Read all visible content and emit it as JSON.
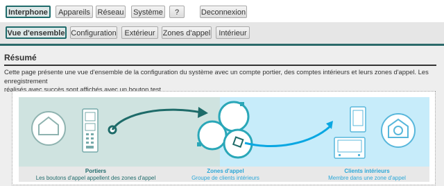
{
  "top_nav": {
    "items": [
      {
        "label": "Interphone",
        "active": true
      },
      {
        "label": "Appareils",
        "active": false
      },
      {
        "label": "Réseau",
        "active": false
      },
      {
        "label": "Système",
        "active": false
      },
      {
        "label": "?",
        "active": false
      }
    ],
    "logout_label": "Deconnexion"
  },
  "sub_nav": {
    "items": [
      {
        "label": "Vue d'ensemble",
        "active": true
      },
      {
        "label": "Configuration",
        "active": false
      },
      {
        "label": "Extérieur",
        "active": false
      },
      {
        "label": "Zones d'appel",
        "active": false
      },
      {
        "label": "Intérieur",
        "active": false
      }
    ]
  },
  "summary": {
    "title": "Résumé",
    "description_line1": "Cette page présente une vue d'ensemble de la configuration du système avec un compte portier, des comptes intérieurs et leurs zones d'appel. Les enregistrement",
    "description_line2": "réalisés avec succès sont affichés avec un bouton test."
  },
  "diagram": {
    "columns": [
      {
        "title": "Portiers",
        "caption": "Les boutons d'appel appellent des zones d'appel"
      },
      {
        "title": "Zones d'appel",
        "caption": "Groupe de clients intérieurs"
      },
      {
        "title": "Clients intérieurs",
        "caption": "Membre dans une zone d'appel"
      }
    ]
  },
  "colors": {
    "accent": "#2b6a6a",
    "teal_panel": "#cfe3e0",
    "blue_panel": "#c7ecfa",
    "arrow_dark": "#1e6b69",
    "arrow_blue": "#0aa7e2",
    "label_teal": "#1f6b6b",
    "label_blue": "#2aa7d8"
  }
}
